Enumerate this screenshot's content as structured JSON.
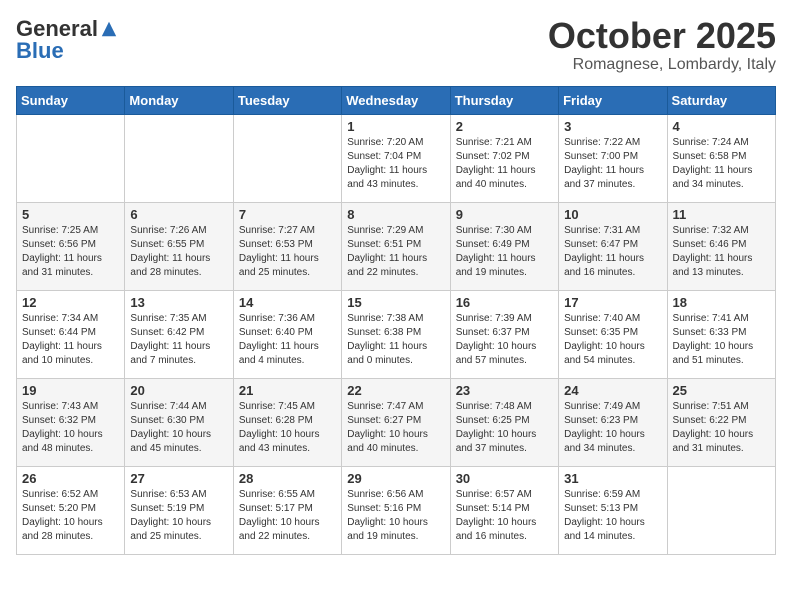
{
  "logo": {
    "general": "General",
    "blue": "Blue"
  },
  "header": {
    "month": "October 2025",
    "location": "Romagnese, Lombardy, Italy"
  },
  "weekdays": [
    "Sunday",
    "Monday",
    "Tuesday",
    "Wednesday",
    "Thursday",
    "Friday",
    "Saturday"
  ],
  "weeks": [
    [
      {
        "day": "",
        "info": ""
      },
      {
        "day": "",
        "info": ""
      },
      {
        "day": "",
        "info": ""
      },
      {
        "day": "1",
        "info": "Sunrise: 7:20 AM\nSunset: 7:04 PM\nDaylight: 11 hours\nand 43 minutes."
      },
      {
        "day": "2",
        "info": "Sunrise: 7:21 AM\nSunset: 7:02 PM\nDaylight: 11 hours\nand 40 minutes."
      },
      {
        "day": "3",
        "info": "Sunrise: 7:22 AM\nSunset: 7:00 PM\nDaylight: 11 hours\nand 37 minutes."
      },
      {
        "day": "4",
        "info": "Sunrise: 7:24 AM\nSunset: 6:58 PM\nDaylight: 11 hours\nand 34 minutes."
      }
    ],
    [
      {
        "day": "5",
        "info": "Sunrise: 7:25 AM\nSunset: 6:56 PM\nDaylight: 11 hours\nand 31 minutes."
      },
      {
        "day": "6",
        "info": "Sunrise: 7:26 AM\nSunset: 6:55 PM\nDaylight: 11 hours\nand 28 minutes."
      },
      {
        "day": "7",
        "info": "Sunrise: 7:27 AM\nSunset: 6:53 PM\nDaylight: 11 hours\nand 25 minutes."
      },
      {
        "day": "8",
        "info": "Sunrise: 7:29 AM\nSunset: 6:51 PM\nDaylight: 11 hours\nand 22 minutes."
      },
      {
        "day": "9",
        "info": "Sunrise: 7:30 AM\nSunset: 6:49 PM\nDaylight: 11 hours\nand 19 minutes."
      },
      {
        "day": "10",
        "info": "Sunrise: 7:31 AM\nSunset: 6:47 PM\nDaylight: 11 hours\nand 16 minutes."
      },
      {
        "day": "11",
        "info": "Sunrise: 7:32 AM\nSunset: 6:46 PM\nDaylight: 11 hours\nand 13 minutes."
      }
    ],
    [
      {
        "day": "12",
        "info": "Sunrise: 7:34 AM\nSunset: 6:44 PM\nDaylight: 11 hours\nand 10 minutes."
      },
      {
        "day": "13",
        "info": "Sunrise: 7:35 AM\nSunset: 6:42 PM\nDaylight: 11 hours\nand 7 minutes."
      },
      {
        "day": "14",
        "info": "Sunrise: 7:36 AM\nSunset: 6:40 PM\nDaylight: 11 hours\nand 4 minutes."
      },
      {
        "day": "15",
        "info": "Sunrise: 7:38 AM\nSunset: 6:38 PM\nDaylight: 11 hours\nand 0 minutes."
      },
      {
        "day": "16",
        "info": "Sunrise: 7:39 AM\nSunset: 6:37 PM\nDaylight: 10 hours\nand 57 minutes."
      },
      {
        "day": "17",
        "info": "Sunrise: 7:40 AM\nSunset: 6:35 PM\nDaylight: 10 hours\nand 54 minutes."
      },
      {
        "day": "18",
        "info": "Sunrise: 7:41 AM\nSunset: 6:33 PM\nDaylight: 10 hours\nand 51 minutes."
      }
    ],
    [
      {
        "day": "19",
        "info": "Sunrise: 7:43 AM\nSunset: 6:32 PM\nDaylight: 10 hours\nand 48 minutes."
      },
      {
        "day": "20",
        "info": "Sunrise: 7:44 AM\nSunset: 6:30 PM\nDaylight: 10 hours\nand 45 minutes."
      },
      {
        "day": "21",
        "info": "Sunrise: 7:45 AM\nSunset: 6:28 PM\nDaylight: 10 hours\nand 43 minutes."
      },
      {
        "day": "22",
        "info": "Sunrise: 7:47 AM\nSunset: 6:27 PM\nDaylight: 10 hours\nand 40 minutes."
      },
      {
        "day": "23",
        "info": "Sunrise: 7:48 AM\nSunset: 6:25 PM\nDaylight: 10 hours\nand 37 minutes."
      },
      {
        "day": "24",
        "info": "Sunrise: 7:49 AM\nSunset: 6:23 PM\nDaylight: 10 hours\nand 34 minutes."
      },
      {
        "day": "25",
        "info": "Sunrise: 7:51 AM\nSunset: 6:22 PM\nDaylight: 10 hours\nand 31 minutes."
      }
    ],
    [
      {
        "day": "26",
        "info": "Sunrise: 6:52 AM\nSunset: 5:20 PM\nDaylight: 10 hours\nand 28 minutes."
      },
      {
        "day": "27",
        "info": "Sunrise: 6:53 AM\nSunset: 5:19 PM\nDaylight: 10 hours\nand 25 minutes."
      },
      {
        "day": "28",
        "info": "Sunrise: 6:55 AM\nSunset: 5:17 PM\nDaylight: 10 hours\nand 22 minutes."
      },
      {
        "day": "29",
        "info": "Sunrise: 6:56 AM\nSunset: 5:16 PM\nDaylight: 10 hours\nand 19 minutes."
      },
      {
        "day": "30",
        "info": "Sunrise: 6:57 AM\nSunset: 5:14 PM\nDaylight: 10 hours\nand 16 minutes."
      },
      {
        "day": "31",
        "info": "Sunrise: 6:59 AM\nSunset: 5:13 PM\nDaylight: 10 hours\nand 14 minutes."
      },
      {
        "day": "",
        "info": ""
      }
    ]
  ]
}
